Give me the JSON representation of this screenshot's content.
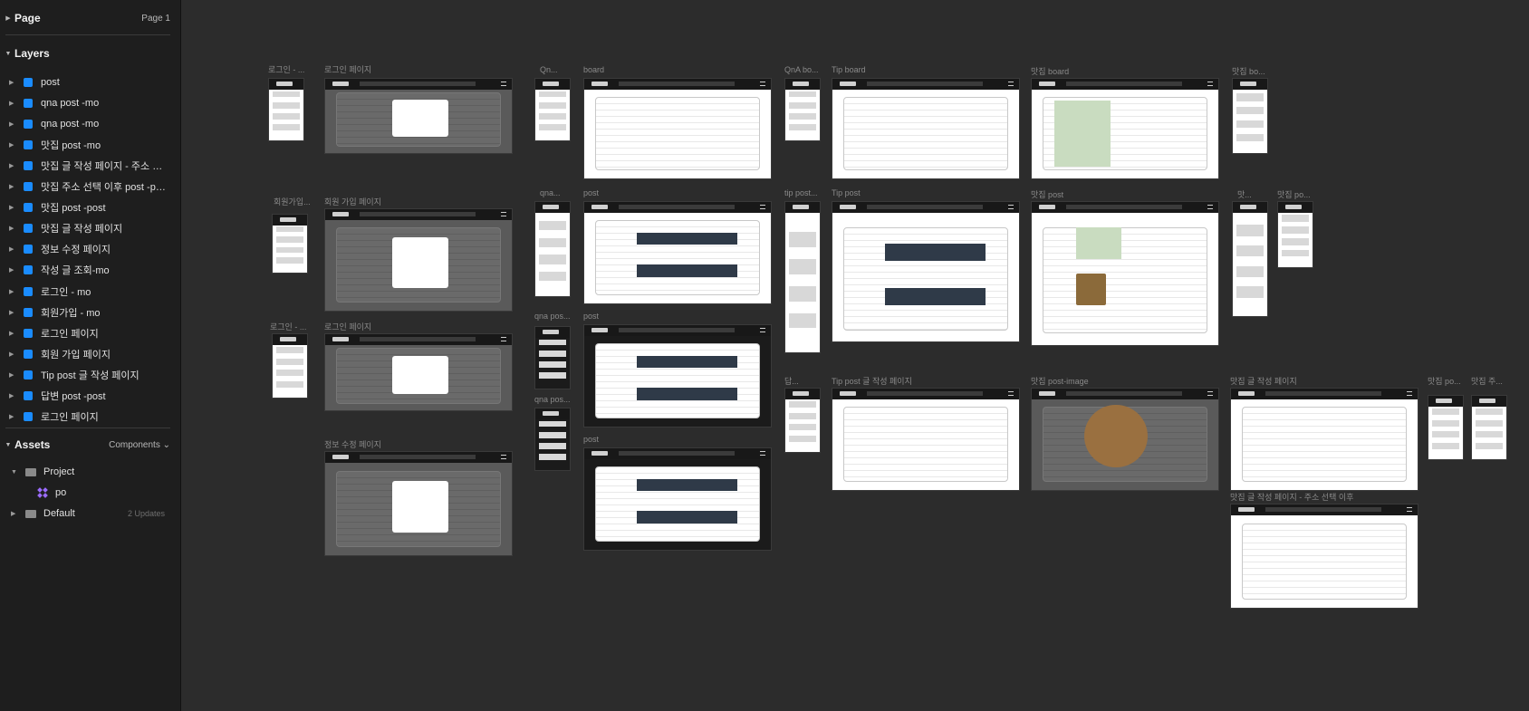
{
  "page": {
    "section_title": "Page",
    "current_page": "Page 1"
  },
  "layers": {
    "section_title": "Layers",
    "items": [
      {
        "label": "post"
      },
      {
        "label": "qna post -mo"
      },
      {
        "label": "qna post -mo"
      },
      {
        "label": "맛집 post -mo"
      },
      {
        "label": "맛집 글 작성 페이지 - 주소 선..."
      },
      {
        "label": "맛집 주소 선택 이후 post -po..."
      },
      {
        "label": "맛집 post -post"
      },
      {
        "label": "맛집 글 작성 페이지"
      },
      {
        "label": "정보 수정 페이지"
      },
      {
        "label": "작성 글 조회-mo"
      },
      {
        "label": "로그인 - mo"
      },
      {
        "label": "회원가입 - mo"
      },
      {
        "label": "로그인 페이지"
      },
      {
        "label": "회원 가입 페이지"
      },
      {
        "label": "Tip post 글 작성 페이지"
      },
      {
        "label": "답변 post -post"
      },
      {
        "label": "로그인 페이지"
      }
    ]
  },
  "assets": {
    "section_title": "Assets",
    "components_label": "Components",
    "items": [
      {
        "label": "Project",
        "expanded": true,
        "type": "folder"
      },
      {
        "label": "po",
        "type": "component"
      },
      {
        "label": "Default",
        "type": "folder",
        "note": "2 Updates"
      }
    ]
  },
  "colors": {
    "sidebar_bg": "#1e1e1e",
    "canvas_bg": "#2c2c2c",
    "frame_icon": "#1a8cff",
    "component_icon": "#9b6cff"
  },
  "canvas": {
    "frames": [
      {
        "label": "로그인 - ..."
      },
      {
        "label": "로그인 페이지"
      },
      {
        "label": "Qn..."
      },
      {
        "label": "board"
      },
      {
        "label": "QnA bo..."
      },
      {
        "label": "Tip board"
      },
      {
        "label": "맛집 board"
      },
      {
        "label": "맛집 bo..."
      },
      {
        "label": "회원가입..."
      },
      {
        "label": "회원 가입 페이지"
      },
      {
        "label": "qna..."
      },
      {
        "label": "post"
      },
      {
        "label": "tip post..."
      },
      {
        "label": "Tip post"
      },
      {
        "label": "맛집 post"
      },
      {
        "label": "맛..."
      },
      {
        "label": "맛집 po..."
      },
      {
        "label": "로그인 - ..."
      },
      {
        "label": "로그인 페이지"
      },
      {
        "label": "qna pos..."
      },
      {
        "label": "post"
      },
      {
        "label": "답..."
      },
      {
        "label": "Tip post 글 작성 페이지"
      },
      {
        "label": "맛집 post-image"
      },
      {
        "label": "맛집 글 작성 페이지"
      },
      {
        "label": "맛집 po..."
      },
      {
        "label": "맛집 주..."
      },
      {
        "label": "qna pos..."
      },
      {
        "label": "정보 수정 페이지"
      },
      {
        "label": "post"
      },
      {
        "label": "맛집 글 작성 페이지 - 주소 선택 이후"
      }
    ]
  }
}
